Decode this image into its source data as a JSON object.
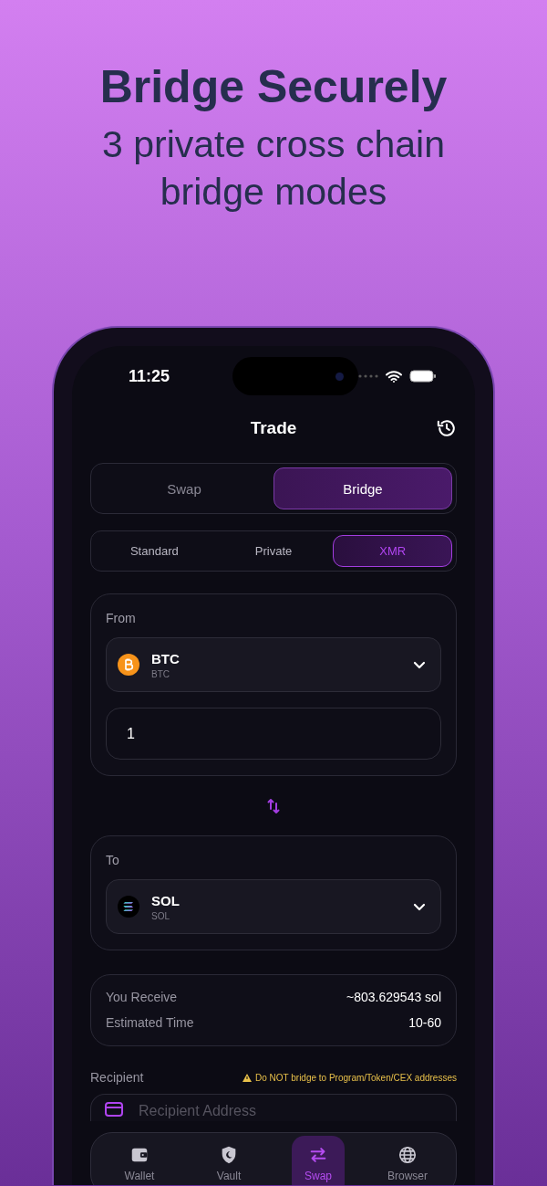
{
  "headline": "Bridge Securely",
  "subheadline": "3 private cross chain bridge modes",
  "status_bar": {
    "time": "11:25"
  },
  "header": {
    "title": "Trade"
  },
  "mode_tabs": [
    {
      "label": "Swap",
      "selected": false
    },
    {
      "label": "Bridge",
      "selected": true
    }
  ],
  "bridge_modes": [
    {
      "label": "Standard",
      "selected": false
    },
    {
      "label": "Private",
      "selected": false
    },
    {
      "label": "XMR",
      "selected": true
    }
  ],
  "from": {
    "label": "From",
    "token": {
      "symbol": "BTC",
      "network": "BTC",
      "kind": "btc"
    },
    "amount": "1"
  },
  "to": {
    "label": "To",
    "token": {
      "symbol": "SOL",
      "network": "SOL",
      "kind": "sol"
    }
  },
  "summary": [
    {
      "label": "You Receive",
      "value": "~803.629543 sol"
    },
    {
      "label": "Estimated Time",
      "value": "10-60"
    }
  ],
  "recipient": {
    "label": "Recipient",
    "warning": "Do NOT bridge to Program/Token/CEX addresses",
    "placeholder": "Recipient Address"
  },
  "nav": [
    {
      "label": "Wallet",
      "kind": "wallet",
      "selected": false
    },
    {
      "label": "Vault",
      "kind": "vault",
      "selected": false
    },
    {
      "label": "Swap",
      "kind": "swap",
      "selected": true
    },
    {
      "label": "Browser",
      "kind": "browser",
      "selected": false
    }
  ]
}
